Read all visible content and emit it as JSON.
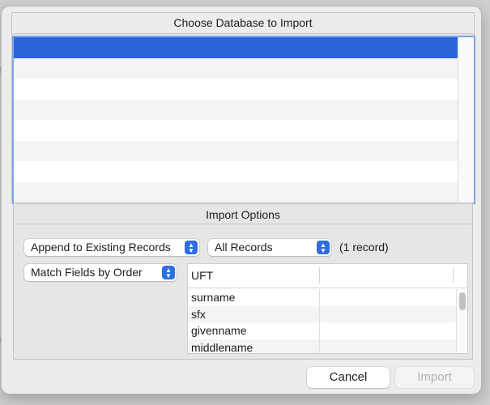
{
  "background": {
    "letters": [
      "n",
      "r"
    ]
  },
  "database_group": {
    "title": "Choose Database to Import",
    "rows": [
      "",
      "",
      "",
      "",
      "",
      "",
      "",
      ""
    ]
  },
  "options_group": {
    "title": "Import Options",
    "mode_popup": "Append to Existing Records",
    "records_popup": "All Records",
    "record_count": "(1 record)",
    "match_popup": "Match Fields by Order",
    "field_table": {
      "column_header": "UFT",
      "fields": [
        "surname",
        "sfx",
        "givenname",
        "middlename"
      ]
    }
  },
  "buttons": {
    "cancel": "Cancel",
    "import": "Import"
  },
  "colors": {
    "selection": "#2a66d9",
    "accent": "#2f6fe0"
  }
}
